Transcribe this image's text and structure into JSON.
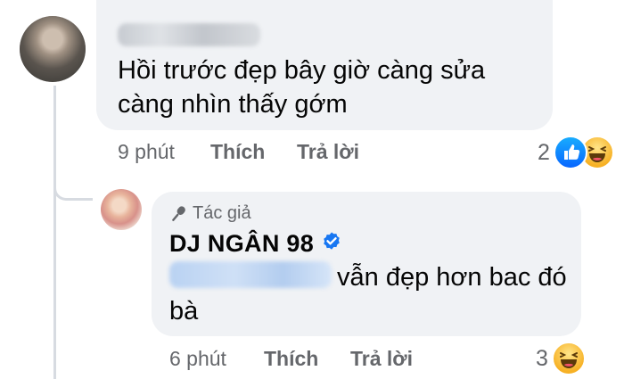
{
  "comment": {
    "text": "Hồi trước đẹp bây giờ càng sửa càng nhìn thấy gớm",
    "time": "9 phút",
    "like_label": "Thích",
    "reply_label": "Trả lời",
    "reaction_count": "2",
    "reaction_icons": [
      "like-icon",
      "haha-icon"
    ]
  },
  "reply": {
    "author_badge": "Tác giả",
    "page_name": "DJ NGÂN 98",
    "verified_icon": "verified-badge-icon",
    "text_line1": "vẫn đẹp hơn bac đó",
    "text_line2": "bà",
    "time": "6 phút",
    "like_label": "Thích",
    "reply_label": "Trả lời",
    "reaction_count": "3",
    "reaction_icons": [
      "haha-icon"
    ]
  },
  "colors": {
    "bubble": "#f0f2f5",
    "secondary_text": "#65676b",
    "verified_blue": "#1877f2",
    "like_blue": "#0866ff",
    "haha_yellow": "#f7b125"
  }
}
